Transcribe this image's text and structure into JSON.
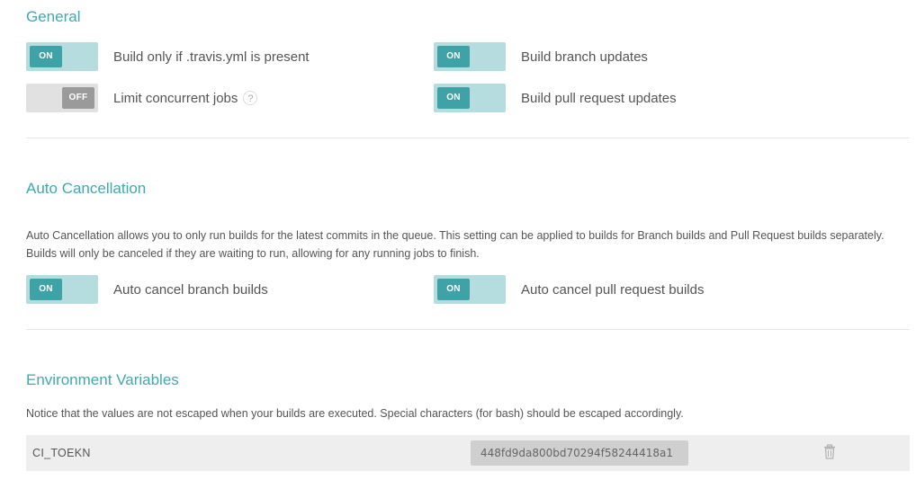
{
  "general": {
    "title": "General",
    "options": [
      {
        "label": "Build only if .travis.yml is present",
        "state": "ON"
      },
      {
        "label": "Build branch updates",
        "state": "ON"
      },
      {
        "label": "Limit concurrent jobs",
        "state": "OFF",
        "help": "?"
      },
      {
        "label": "Build pull request updates",
        "state": "ON"
      }
    ]
  },
  "auto_cancellation": {
    "title": "Auto Cancellation",
    "description": "Auto Cancellation allows you to only run builds for the latest commits in the queue. This setting can be applied to builds for Branch builds and Pull Request builds separately. Builds will only be canceled if they are waiting to run, allowing for any running jobs to finish.",
    "options": [
      {
        "label": "Auto cancel branch builds",
        "state": "ON"
      },
      {
        "label": "Auto cancel pull request builds",
        "state": "ON"
      }
    ]
  },
  "env_vars": {
    "title": "Environment Variables",
    "notice": "Notice that the values are not escaped when your builds are executed. Special characters (for bash) should be escaped accordingly.",
    "rows": [
      {
        "name": "CI_TOEKN",
        "value": "448fd9da800bd70294f58244418a1"
      }
    ]
  },
  "colors": {
    "accent": "#3eaaaf",
    "toggle_on_track": "#b5dcdf",
    "toggle_on_knob": "#3ea2a6",
    "toggle_off_track": "#e1e1e1",
    "toggle_off_knob": "#9a9a9a"
  },
  "icons": {
    "help": "question-mark-circle",
    "delete": "trash-can"
  }
}
